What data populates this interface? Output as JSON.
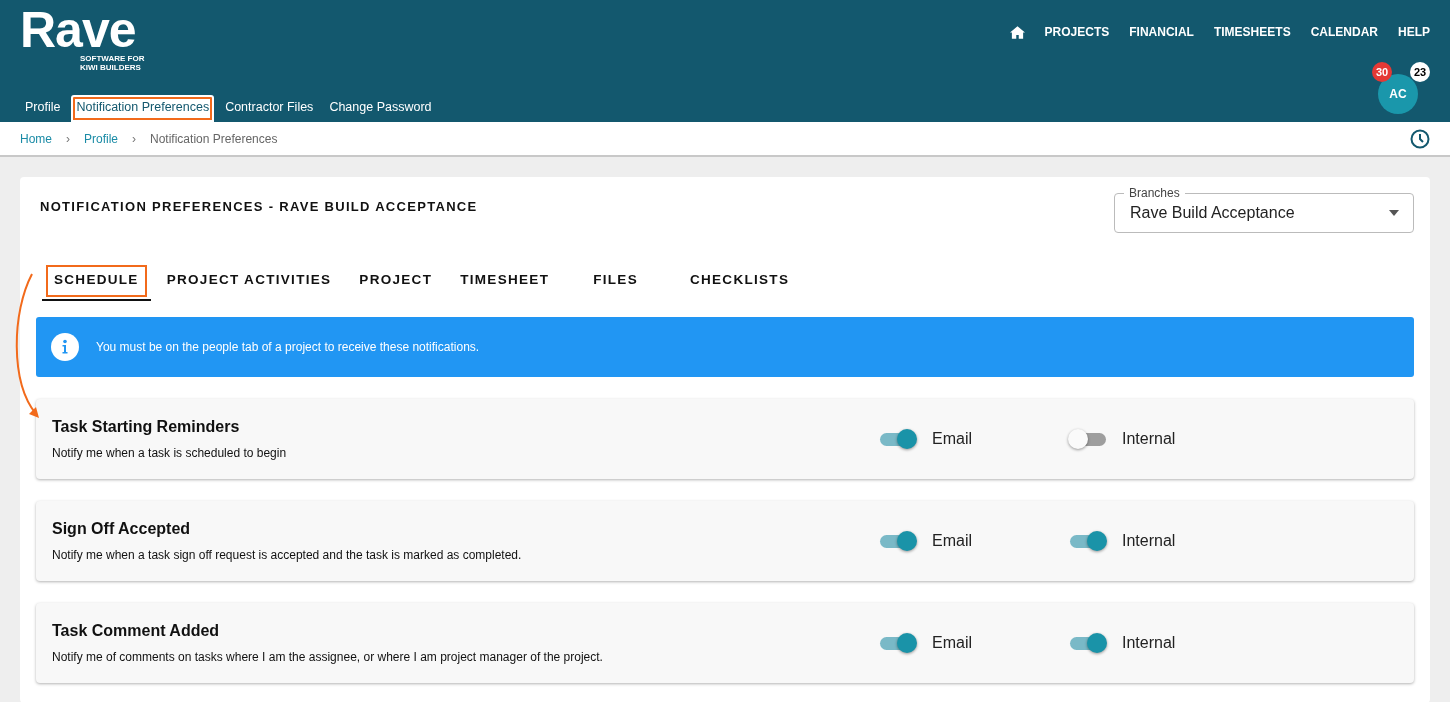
{
  "logo": {
    "name": "Rave",
    "tagline_1": "SOFTWARE FOR",
    "tagline_2": "KIWI BUILDERS"
  },
  "top_nav": [
    "PROJECTS",
    "FINANCIAL",
    "TIMESHEETS",
    "CALENDAR",
    "HELP"
  ],
  "profile_tabs": [
    {
      "label": "Profile",
      "selected": false,
      "annotated": false
    },
    {
      "label": "Notification Preferences",
      "selected": true,
      "annotated": true
    },
    {
      "label": "Contractor Files",
      "selected": false,
      "annotated": false
    },
    {
      "label": "Change Password",
      "selected": false,
      "annotated": false
    }
  ],
  "user": {
    "initials": "AC",
    "badge_1": "30",
    "badge_2": "23"
  },
  "breadcrumb_separator": "›",
  "breadcrumb": [
    {
      "label": "Home",
      "kind": "link"
    },
    {
      "label": "Profile",
      "kind": "link"
    },
    {
      "label": "Notification Preferences",
      "kind": "current"
    }
  ],
  "card": {
    "title": "NOTIFICATION PREFERENCES - RAVE BUILD ACCEPTANCE",
    "branches": {
      "label": "Branches",
      "value": "Rave Build Acceptance"
    },
    "tabs": [
      {
        "label": "SCHEDULE",
        "selected": true,
        "annotated": true
      },
      {
        "label": "PROJECT ACTIVITIES",
        "selected": false,
        "annotated": false
      },
      {
        "label": "PROJECT",
        "selected": false,
        "annotated": false
      },
      {
        "label": "TIMESHEET",
        "selected": false,
        "annotated": false
      },
      {
        "label": "FILES",
        "selected": false,
        "annotated": false
      },
      {
        "label": "CHECKLISTS",
        "selected": false,
        "annotated": false
      }
    ],
    "info": "You must be on the people tab of a project to receive these notifications.",
    "annotation_arrow": true,
    "notifications": [
      {
        "title": "Task Starting Reminders",
        "description": "Notify me when a task is scheduled to begin",
        "toggles": [
          {
            "label": "Email",
            "on": true
          },
          {
            "label": "Internal",
            "on": false
          }
        ]
      },
      {
        "title": "Sign Off Accepted",
        "description": "Notify me when a task sign off request is accepted and the task is marked as completed.",
        "toggles": [
          {
            "label": "Email",
            "on": true
          },
          {
            "label": "Internal",
            "on": true
          }
        ]
      },
      {
        "title": "Task Comment Added",
        "description": "Notify me of comments on tasks where I am the assignee, or where I am project manager of the project.",
        "toggles": [
          {
            "label": "Email",
            "on": true
          },
          {
            "label": "Internal",
            "on": true
          }
        ]
      }
    ]
  }
}
